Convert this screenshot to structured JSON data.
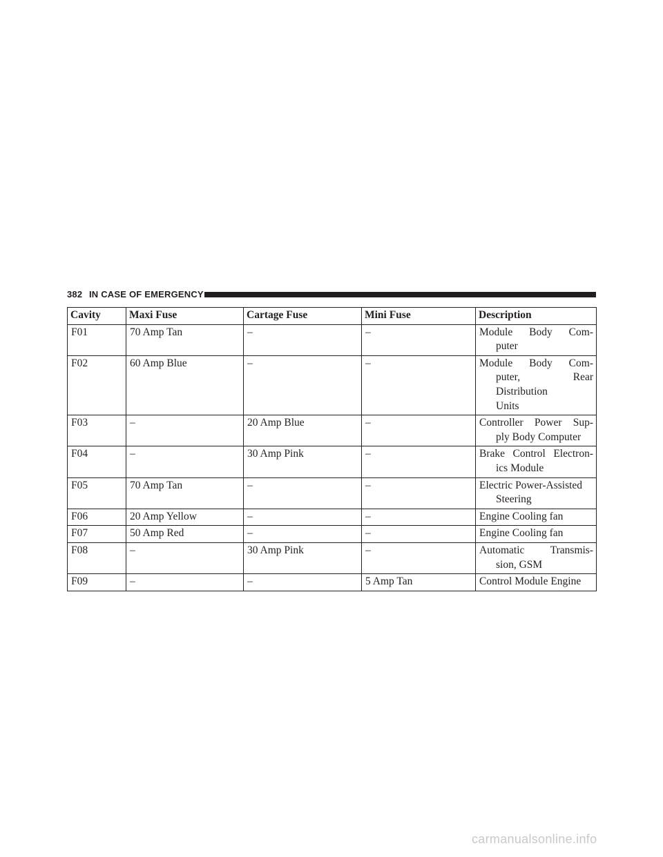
{
  "header": {
    "page_number": "382",
    "section_title": "IN CASE OF EMERGENCY"
  },
  "table": {
    "columns": [
      "Cavity",
      "Maxi Fuse",
      "Cartage Fuse",
      "Mini Fuse",
      "Description"
    ],
    "rows": [
      {
        "cavity": "F01",
        "maxi": "70 Amp Tan",
        "cartage": "–",
        "mini": "–",
        "description": [
          "Module Body Com-",
          "puter"
        ]
      },
      {
        "cavity": "F02",
        "maxi": "60 Amp Blue",
        "cartage": "–",
        "mini": "–",
        "description": [
          "Module Body Com-",
          "puter, Rear Distribution",
          "Units"
        ]
      },
      {
        "cavity": "F03",
        "maxi": "–",
        "cartage": "20 Amp Blue",
        "mini": "–",
        "description": [
          "Controller Power Sup-",
          "ply Body Computer"
        ]
      },
      {
        "cavity": "F04",
        "maxi": "–",
        "cartage": "30 Amp Pink",
        "mini": "–",
        "description": [
          "Brake Control Electron-",
          "ics Module"
        ]
      },
      {
        "cavity": "F05",
        "maxi": "70 Amp Tan",
        "cartage": "–",
        "mini": "–",
        "description": [
          "Electric Power-Assisted",
          "Steering"
        ]
      },
      {
        "cavity": "F06",
        "maxi": "20 Amp Yellow",
        "cartage": "–",
        "mini": "–",
        "description": [
          "Engine Cooling fan"
        ]
      },
      {
        "cavity": "F07",
        "maxi": "50 Amp Red",
        "cartage": "–",
        "mini": "–",
        "description": [
          "Engine Cooling fan"
        ]
      },
      {
        "cavity": "F08",
        "maxi": "–",
        "cartage": "30 Amp Pink",
        "mini": "–",
        "description": [
          "Automatic Transmis-",
          "sion, GSM"
        ]
      },
      {
        "cavity": "F09",
        "maxi": "–",
        "cartage": "–",
        "mini": "5 Amp Tan",
        "description": [
          "Control Module Engine"
        ]
      }
    ]
  },
  "watermark": "carmanualsonline.info"
}
